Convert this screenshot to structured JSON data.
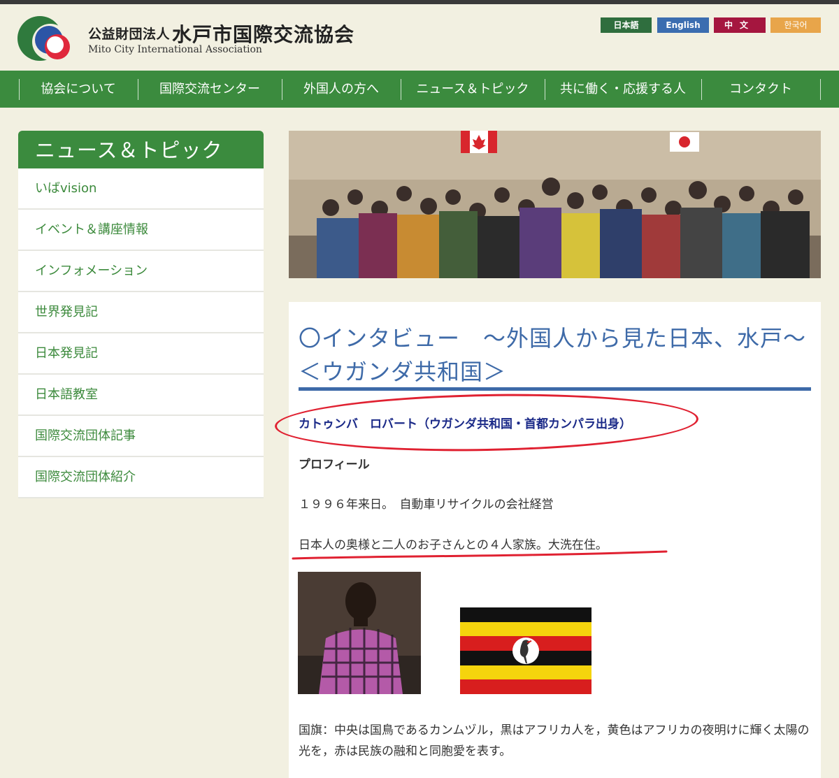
{
  "header": {
    "org_prefix": "公益財団法人",
    "org_name": "水戸市国際交流協会",
    "org_name_en": "Mito City International Association",
    "languages": [
      "日本語",
      "English",
      "中文",
      "한국어"
    ]
  },
  "nav": {
    "items": [
      "協会について",
      "国際交流センター",
      "外国人の方へ",
      "ニュース＆トピック",
      "共に働く・応援する人",
      "コンタクト"
    ]
  },
  "sidebar": {
    "heading": "ニュース＆トピック",
    "items": [
      "いばvision",
      "イベント＆講座情報",
      "インフォメーション",
      "世界発見記",
      "日本発見記",
      "日本語教室",
      "国際交流団体記事",
      "国際交流団体紹介"
    ]
  },
  "article": {
    "title": "〇インタビュー　～外国人から見た日本、水戸～ ＜ウガンダ共和国＞",
    "interviewee": "カトゥンバ　ロバート（ウガンダ共和国・首都カンパラ出身）",
    "profile_heading": "プロフィール",
    "profile_line1": "１９９６年来日。　自動車リサイクルの会社経営",
    "profile_line2": "日本人の奥様と二人のお子さんとの４人家族。大洗在住。",
    "flag_caption": "国旗：中央は国鳥であるカンムヅル，黒はアフリカ人を，黄色はアフリカの夜明けに輝く太陽の光を，赤は民族の融和と同胞愛を表す。"
  },
  "colors": {
    "nav_green": "#3b8b3e",
    "title_blue": "#3e6aa8",
    "annotation_red": "#e02131"
  }
}
